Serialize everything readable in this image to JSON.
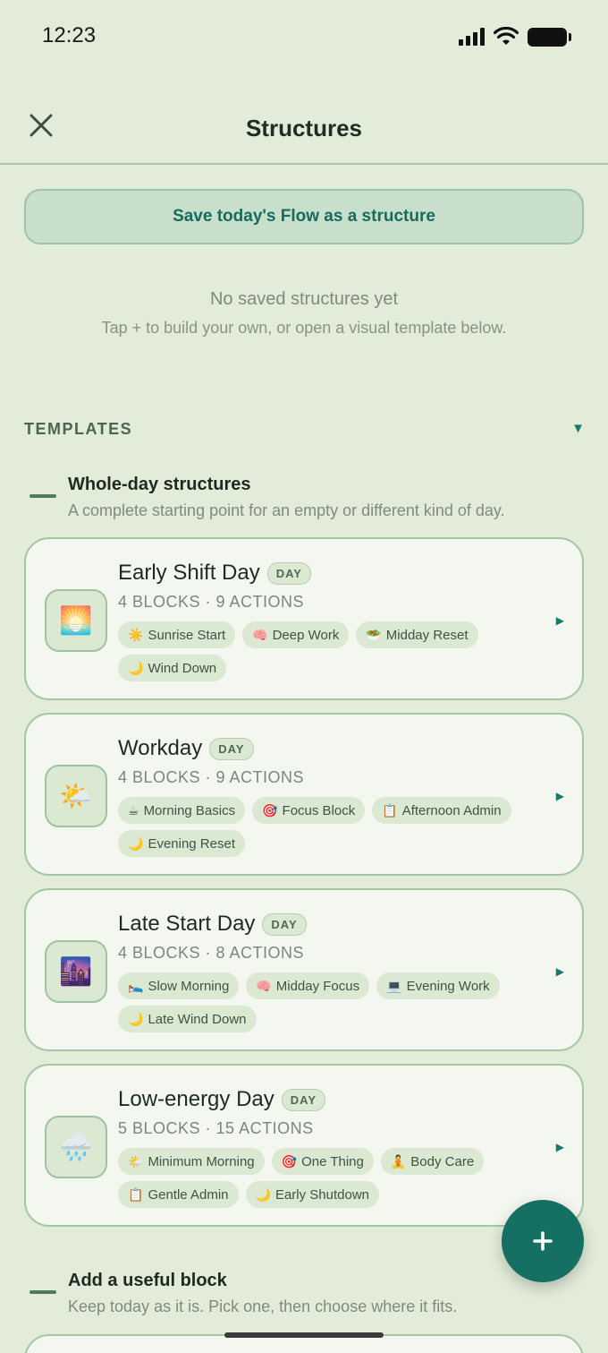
{
  "status": {
    "time": "12:23"
  },
  "header": {
    "title": "Structures",
    "close_icon": "close-icon"
  },
  "save_button": "Save today's Flow as a structure",
  "empty_state": {
    "title": "No saved structures yet",
    "subtitle": "Tap + to build your own, or open a visual template below."
  },
  "templates": {
    "label": "TEMPLATES",
    "toggle": "▼",
    "whole_day": {
      "title": "Whole-day structures",
      "subtitle": "A complete starting point for an empty or different kind of day."
    },
    "cards": [
      {
        "icon": "🌅",
        "title": "Early Shift Day",
        "badge": "DAY",
        "meta": "4 BLOCKS · 9 ACTIONS",
        "arrow": "▶",
        "chips": [
          {
            "emoji": "☀️",
            "label": "Sunrise Start"
          },
          {
            "emoji": "🧠",
            "label": "Deep Work"
          },
          {
            "emoji": "🥗",
            "label": "Midday Reset"
          },
          {
            "emoji": "🌙",
            "label": "Wind Down"
          }
        ]
      },
      {
        "icon": "🌤️",
        "title": "Workday",
        "badge": "DAY",
        "meta": "4 BLOCKS · 9 ACTIONS",
        "arrow": "▶",
        "chips": [
          {
            "emoji": "☕",
            "label": "Morning Basics"
          },
          {
            "emoji": "🎯",
            "label": "Focus Block"
          },
          {
            "emoji": "📋",
            "label": "Afternoon Admin"
          },
          {
            "emoji": "🌙",
            "label": "Evening Reset"
          }
        ]
      },
      {
        "icon": "🌆",
        "title": "Late Start Day",
        "badge": "DAY",
        "meta": "4 BLOCKS · 8 ACTIONS",
        "arrow": "▶",
        "chips": [
          {
            "emoji": "🛌",
            "label": "Slow Morning"
          },
          {
            "emoji": "🧠",
            "label": "Midday Focus"
          },
          {
            "emoji": "💻",
            "label": "Evening Work"
          },
          {
            "emoji": "🌙",
            "label": "Late Wind Down"
          }
        ]
      },
      {
        "icon": "🌧️",
        "title": "Low-energy Day",
        "badge": "DAY",
        "meta": "5 BLOCKS · 15 ACTIONS",
        "arrow": "▶",
        "chips": [
          {
            "emoji": "🌤️",
            "label": "Minimum Morning"
          },
          {
            "emoji": "🎯",
            "label": "One Thing"
          },
          {
            "emoji": "🧘",
            "label": "Body Care"
          },
          {
            "emoji": "📋",
            "label": "Gentle Admin"
          },
          {
            "emoji": "🌙",
            "label": "Early Shutdown"
          }
        ]
      }
    ],
    "useful_block": {
      "title": "Add a useful block",
      "subtitle": "Keep today as it is. Pick one, then choose where it fits."
    }
  },
  "fab": {
    "icon": "plus-icon"
  }
}
